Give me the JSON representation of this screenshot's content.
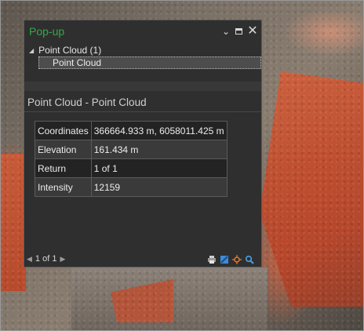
{
  "window": {
    "title": "Pop-up"
  },
  "tree": {
    "group_label": "Point Cloud (1)",
    "item_label": "Point Cloud"
  },
  "feature_title": "Point Cloud - Point Cloud",
  "attributes": [
    {
      "key": "Coordinates",
      "value": "366664.933 m, 6058011.425 m"
    },
    {
      "key": "Elevation",
      "value": "161.434 m"
    },
    {
      "key": "Return",
      "value": "1 of 1"
    },
    {
      "key": "Intensity",
      "value": "12159"
    }
  ],
  "footer": {
    "page_text": "1 of 1"
  },
  "icons": {
    "chevron": "chevron-down-icon",
    "maximize": "maximize-icon",
    "close": "close-icon",
    "print": "print-icon",
    "table": "table-icon",
    "flash": "flash-icon",
    "zoom": "zoom-to-icon"
  },
  "colors": {
    "title": "#36a846",
    "pane_bg": "#2f2f2f",
    "accent_blue": "#3b8bd9"
  }
}
